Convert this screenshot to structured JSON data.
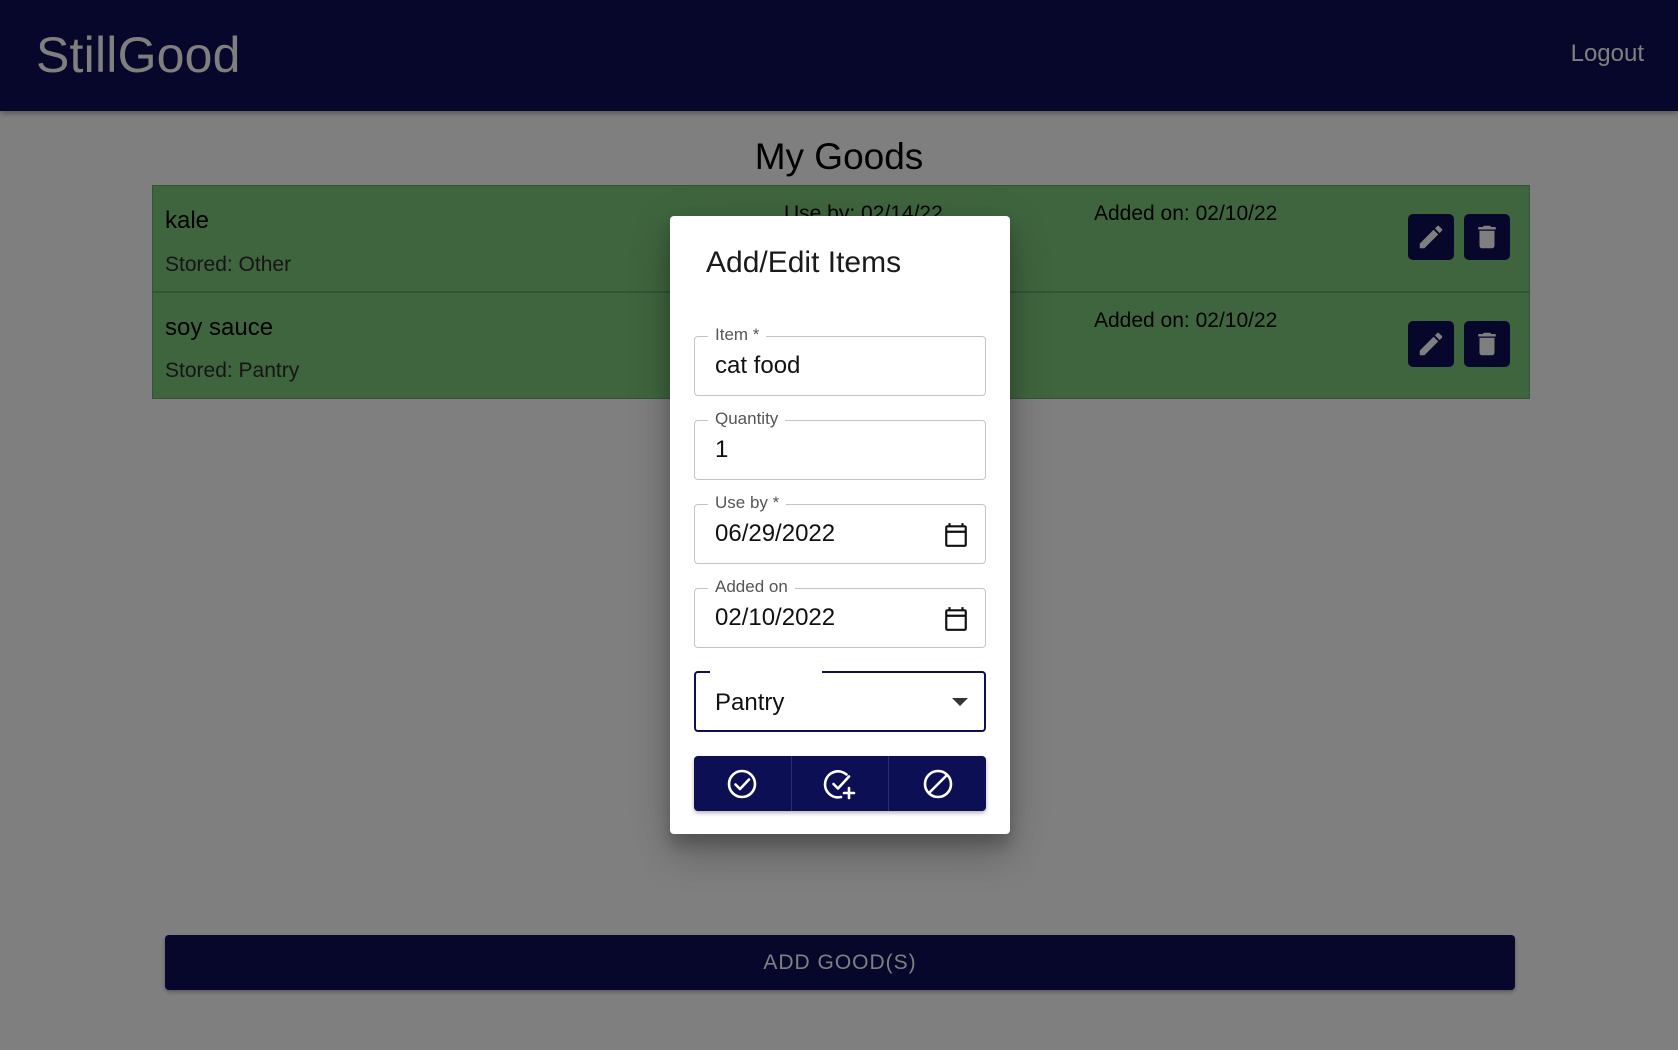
{
  "app": {
    "brand": "StillGood",
    "logout_label": "Logout"
  },
  "main": {
    "title": "My Goods",
    "goods": [
      {
        "name": "kale",
        "stored": "Stored: Other",
        "use_by": "Use by: 02/14/22",
        "added_on": "Added on: 02/10/22"
      },
      {
        "name": "soy sauce",
        "stored": "Stored: Pantry",
        "use_by": "",
        "added_on": "Added on: 02/10/22"
      }
    ],
    "add_button_label": "ADD GOOD(S)"
  },
  "dialog": {
    "title": "Add/Edit Items",
    "fields": {
      "item": {
        "label": "Item *",
        "value": "cat food"
      },
      "quantity": {
        "label": "Quantity",
        "value": "1"
      },
      "use_by": {
        "label": "Use by *",
        "value": "06/29/2022"
      },
      "added_on": {
        "label": "Added on",
        "value": "02/10/2022"
      }
    },
    "storage_select": {
      "value": "Pantry"
    },
    "actions": [
      "check-circle-icon",
      "check-circle-plus-icon",
      "cancel-icon"
    ]
  },
  "colors": {
    "primary": "#0d0f54",
    "row_background": "#7fca7c",
    "backdrop": "rgba(0,0,0,0.5)"
  }
}
